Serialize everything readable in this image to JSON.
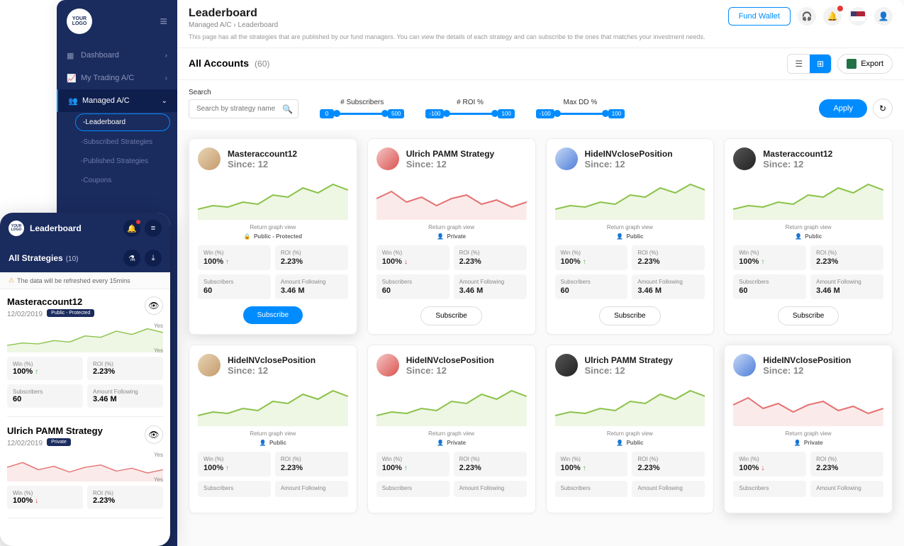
{
  "app": {
    "logo": "YOUR LOGO"
  },
  "sidebar": {
    "items": [
      {
        "label": "Dashboard"
      },
      {
        "label": "My Trading A/C"
      },
      {
        "label": "Managed A/C"
      }
    ],
    "subitems": [
      {
        "label": "-Leaderboard"
      },
      {
        "label": "-Subscribed Strategies"
      },
      {
        "label": "-Published Strategies"
      },
      {
        "label": "-Coupons"
      }
    ]
  },
  "header": {
    "title": "Leaderboard",
    "breadcrumb_parent": "Managed A/C",
    "breadcrumb_current": "Leaderboard",
    "fund_label": "Fund Wallet",
    "desc": "This page has all the strategies that are published by our fund managers. You can view the details of each strategy and can subscribe to the ones that matches your investment needs."
  },
  "section": {
    "title": "All Accounts",
    "count": "(60)",
    "export_label": "Export"
  },
  "filters": {
    "search_label": "Search",
    "search_placeholder": "Search by strategy name",
    "subs_label": "# Subscribers",
    "subs_min": "0",
    "subs_max": "500",
    "roi_label": "# ROI %",
    "roi_min": "-100",
    "roi_max": "100",
    "dd_label": "Max DD %",
    "dd_min": "-100",
    "dd_max": "100",
    "apply_label": "Apply"
  },
  "cards": [
    {
      "name": "Masteraccount12",
      "since": "Since: 12",
      "privacy": "Public - Protected",
      "privacy_icon": "🔒",
      "win_label": "Win (%)",
      "win": "100%",
      "dir": "up",
      "roi_label": "ROI (%)",
      "roi": "2.23%",
      "subs_label": "Subscribers",
      "subs": "60",
      "amt_label": "Amount Following",
      "amt": "3.46 M",
      "btn": "Subscribe",
      "btn_primary": true,
      "chart": "green",
      "avatar": "",
      "highlight": true
    },
    {
      "name": "Ulrich PAMM Strategy",
      "since": "Since: 12",
      "privacy": "Private",
      "privacy_icon": "👤",
      "win_label": "Win (%)",
      "win": "100%",
      "dir": "down",
      "roi_label": "ROI (%)",
      "roi": "2.23%",
      "subs_label": "Subscribers",
      "subs": "60",
      "amt_label": "Amount Following",
      "amt": "3.46 M",
      "btn": "Subscribe",
      "btn_primary": false,
      "chart": "red",
      "avatar": "red"
    },
    {
      "name": "HideINVclosePosition",
      "since": "Since: 12",
      "privacy": "Public",
      "privacy_icon": "👤",
      "win_label": "Win (%)",
      "win": "100%",
      "dir": "up",
      "roi_label": "ROI (%)",
      "roi": "2.23%",
      "subs_label": "Subscribers",
      "subs": "60",
      "amt_label": "Amount Following",
      "amt": "3.46 M",
      "btn": "Subscribe",
      "btn_primary": false,
      "chart": "green",
      "avatar": "blue"
    },
    {
      "name": "Masteraccount12",
      "since": "Since: 12",
      "privacy": "Public",
      "privacy_icon": "👤",
      "win_label": "Win (%)",
      "win": "100%",
      "dir": "up",
      "roi_label": "ROI (%)",
      "roi": "2.23%",
      "subs_label": "Subscribers",
      "subs": "60",
      "amt_label": "Amount Following",
      "amt": "3.46 M",
      "btn": "Subscribe",
      "btn_primary": false,
      "chart": "green",
      "avatar": "dark"
    },
    {
      "name": "HideINVclosePosition",
      "since": "Since: 12",
      "privacy": "Public",
      "privacy_icon": "👤",
      "win_label": "Win (%)",
      "win": "100%",
      "dir": "up",
      "roi_label": "ROI (%)",
      "roi": "2.23%",
      "subs_label": "Subscribers",
      "subs": "",
      "amt_label": "Amount Following",
      "amt": "",
      "btn": "",
      "chart": "green",
      "avatar": ""
    },
    {
      "name": "HideINVclosePosition",
      "since": "Since: 12",
      "privacy": "Private",
      "privacy_icon": "👤",
      "win_label": "Win (%)",
      "win": "100%",
      "dir": "up",
      "roi_label": "ROI (%)",
      "roi": "2.23%",
      "subs_label": "Subscribers",
      "subs": "",
      "amt_label": "Amount Following",
      "amt": "",
      "btn": "",
      "chart": "green",
      "avatar": "red"
    },
    {
      "name": "Ulrich PAMM Strategy",
      "since": "Since: 12",
      "privacy": "Public",
      "privacy_icon": "👤",
      "win_label": "Win (%)",
      "win": "100%",
      "dir": "up",
      "roi_label": "ROI (%)",
      "roi": "2.23%",
      "subs_label": "Subscribers",
      "subs": "",
      "amt_label": "Amount Following",
      "amt": "",
      "btn": "",
      "chart": "green",
      "avatar": "dark"
    },
    {
      "name": "HideINVclosePosition",
      "since": "Since: 12",
      "privacy": "Private",
      "privacy_icon": "👤",
      "win_label": "Win (%)",
      "win": "100%",
      "dir": "down",
      "roi_label": "ROI (%)",
      "roi": "2.23%",
      "subs_label": "Subscribers",
      "subs": "",
      "amt_label": "Amount Following",
      "amt": "",
      "btn": "",
      "chart": "red",
      "avatar": "blue",
      "highlight": true
    }
  ],
  "card_common": {
    "chart_label": "Return graph view"
  },
  "mobile": {
    "logo": "YOUR LOGO",
    "title": "Leaderboard",
    "subtitle": "All Strategies",
    "count": "(10)",
    "info": "The data will be refreshed every 15mins",
    "yes": "Yes",
    "cards": [
      {
        "name": "Masteraccount12",
        "date": "12/02/2019",
        "badge": "Public - Protected",
        "win_label": "Win (%)",
        "win": "100%",
        "dir": "up",
        "roi_label": "ROI (%)",
        "roi": "2.23%",
        "subs_label": "Subscribers",
        "subs": "60",
        "amt_label": "Amount Following",
        "amt": "3.46 M",
        "chart": "green"
      },
      {
        "name": "Ulrich PAMM Strategy",
        "date": "12/02/2019",
        "badge": "Private",
        "win_label": "Win (%)",
        "win": "100%",
        "dir": "down",
        "roi_label": "ROI (%)",
        "roi": "2.23%",
        "chart": "red"
      }
    ]
  }
}
